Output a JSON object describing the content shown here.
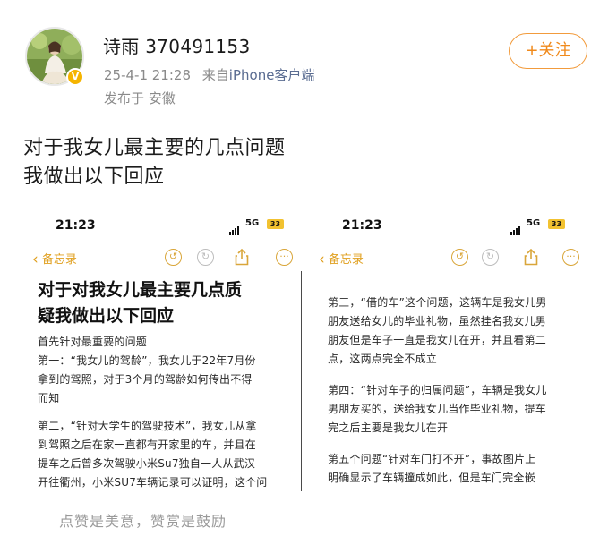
{
  "post": {
    "username": "诗雨 370491153",
    "date": "25-4-1 21:28",
    "source_prefix": "来自",
    "source_device": "iPhone客户端",
    "location": "发布于 安徽",
    "follow_label": "+关注",
    "text_lines": [
      "对于我女儿最主要的几点问题",
      "我做出以下回应"
    ]
  },
  "phone": {
    "time": "21:23",
    "network": "5G",
    "battery": "33",
    "back_label": "备忘录"
  },
  "note_left": {
    "title_lines": [
      "对于对我女儿最主要几点质",
      "疑我做出以下回应"
    ],
    "lines": [
      "首先针对最重要的问题",
      "第一：“我女儿的驾龄”，我女儿于22年7月份",
      "拿到的驾照，对于3个月的驾龄如何传出不得",
      "而知",
      "",
      "第二，“针对大学生的驾驶技术”，我女儿从拿",
      "到驾照之后在家一直都有开家里的车，并且在",
      "提车之后曾多次驾驶小米Su7独自一人从武汉",
      "开往衢州，小米SU7车辆记录可以证明，这个问"
    ]
  },
  "note_right": {
    "lines": [
      "第三，“借的车”这个问题，这辆车是我女儿男",
      "朋友送给女儿的毕业礼物，虽然挂名我女儿男",
      "朋友但是车子一直是我女儿在开，并且看第二",
      "点，这两点完全不成立",
      "",
      "第四：“针对车子的归属问题”，车辆是我女儿",
      "男朋友买的，送给我女儿当作毕业礼物，提车",
      "完之后主要是我女儿在开",
      "",
      "第五个问题“针对车门打不开”，事故图片上",
      "明确显示了车辆撞成如此，但是车门完全嵌"
    ]
  },
  "footer": {
    "text": "点赞是美意，赞赏是鼓励"
  },
  "colors": {
    "accent": "#f08a1c",
    "memo_yellow": "#e0a020",
    "link": "#5a6c91",
    "battery": "#f2c230"
  },
  "icons": [
    "avatar",
    "verified-badge-icon",
    "back-chevron-icon",
    "undo-icon",
    "redo-icon",
    "share-icon",
    "more-icon",
    "signal-icon",
    "battery-icon"
  ]
}
